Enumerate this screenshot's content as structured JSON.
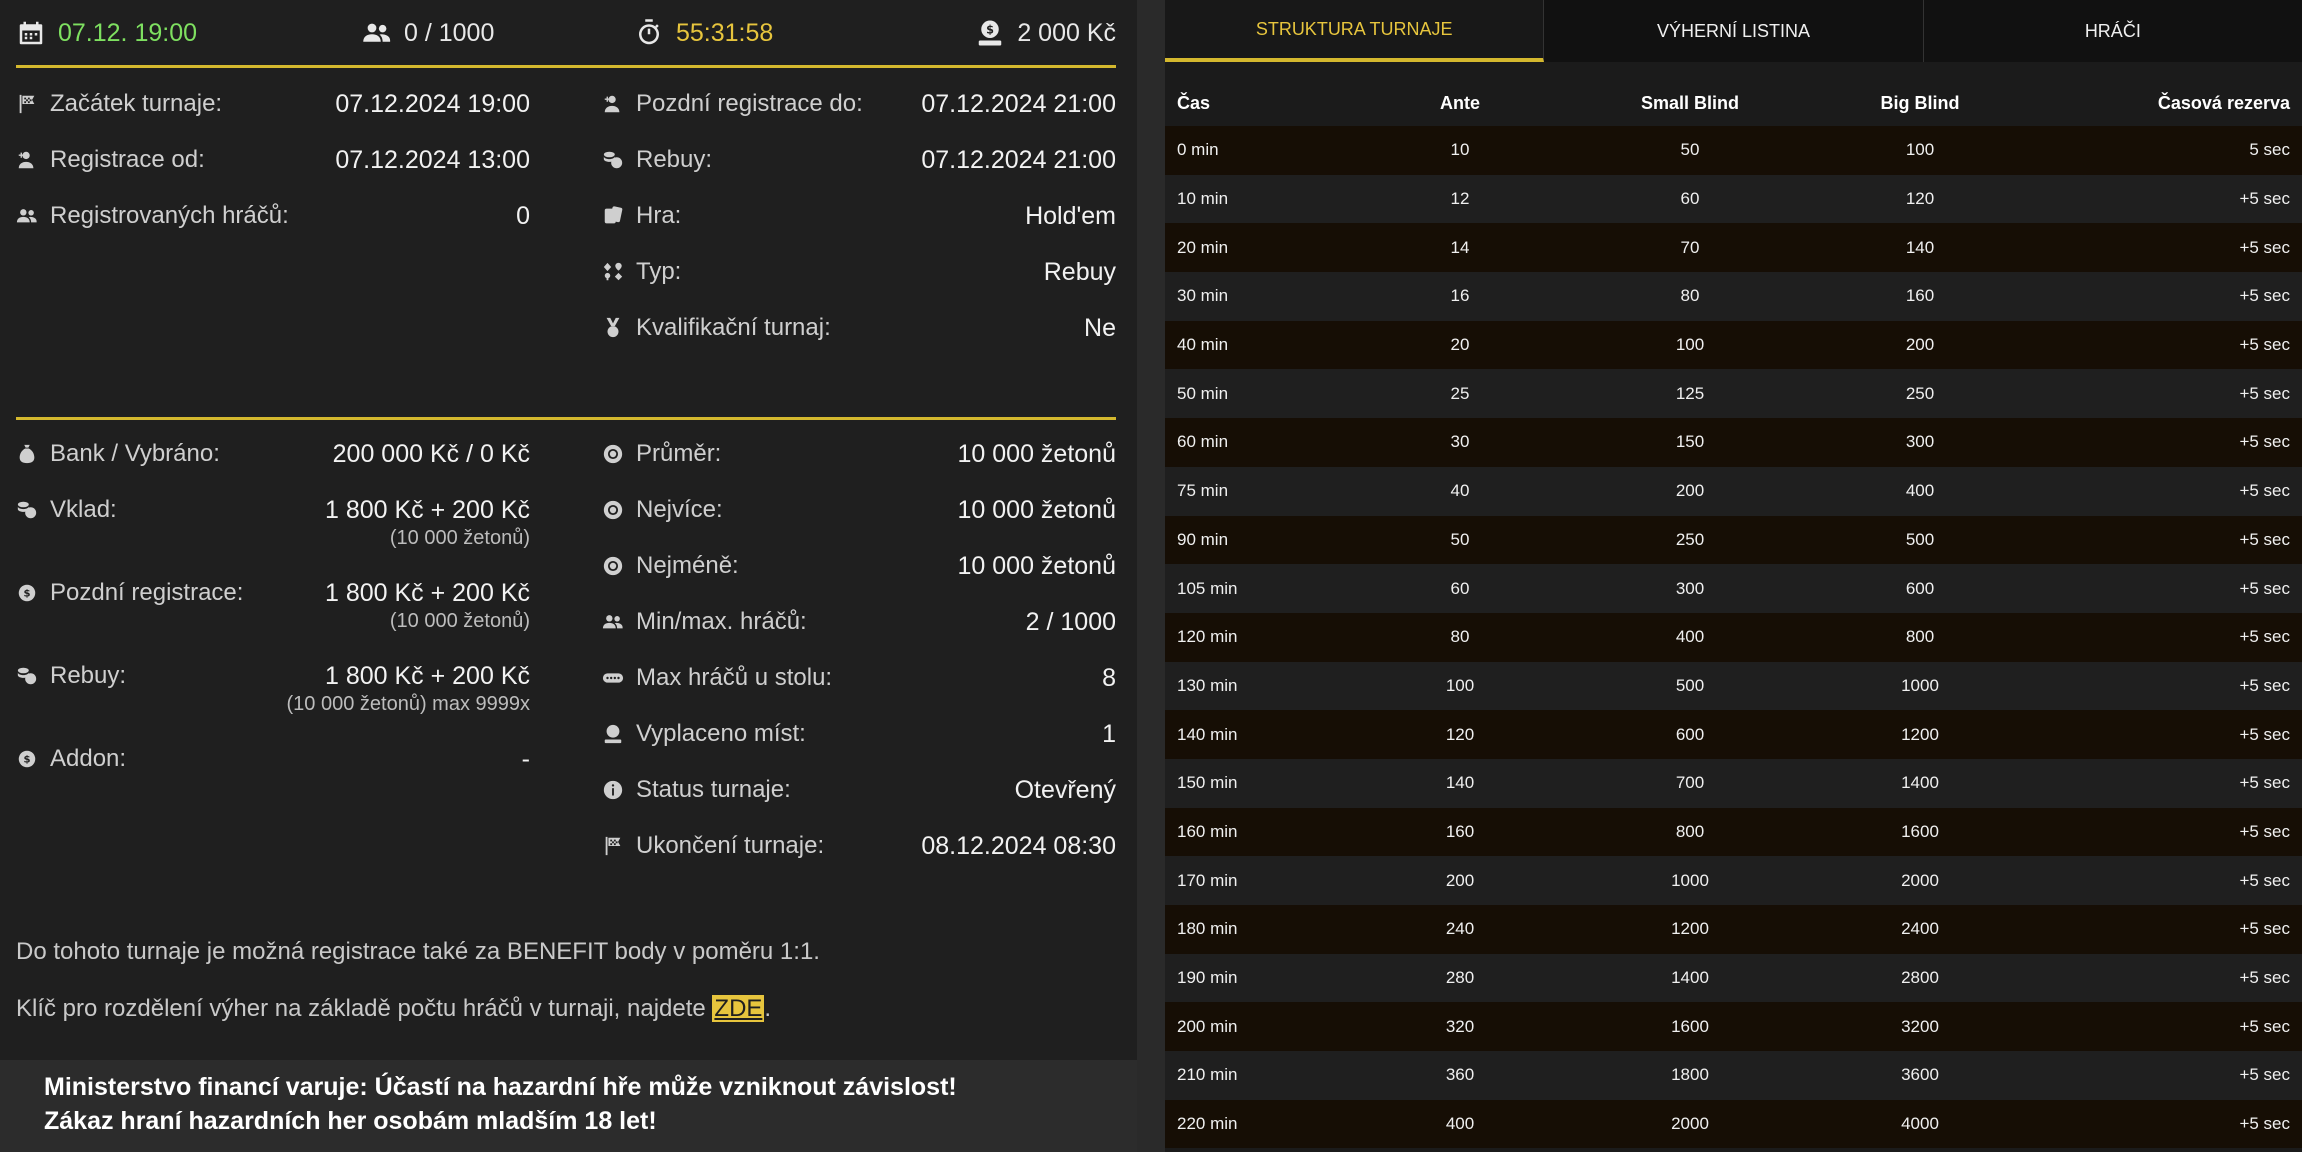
{
  "topbar": {
    "date": "07.12. 19:00",
    "players": "0 / 1000",
    "countdown": "55:31:58",
    "prize": "2 000 Kč"
  },
  "info_left": [
    {
      "label": "Začátek turnaje:",
      "value": "07.12.2024 19:00",
      "icon": "flag-icon"
    },
    {
      "label": "Registrace od:",
      "value": "07.12.2024 13:00",
      "icon": "user-add-icon"
    },
    {
      "label": "Registrovaných hráčů:",
      "value": "0",
      "icon": "users-icon"
    }
  ],
  "info_right": [
    {
      "label": "Pozdní registrace do:",
      "value": "07.12.2024 21:00",
      "icon": "user-add-icon"
    },
    {
      "label": "Rebuy:",
      "value": "07.12.2024 21:00",
      "icon": "coins-icon"
    },
    {
      "label": "Hra:",
      "value": "Hold'em",
      "icon": "cards-icon"
    },
    {
      "label": "Typ:",
      "value": "Rebuy",
      "icon": "suits-icon"
    },
    {
      "label": "Kvalifikační turnaj:",
      "value": "Ne",
      "icon": "medal-icon"
    }
  ],
  "money_left": [
    {
      "label": "Bank / Vybráno:",
      "value": "200 000 Kč / 0 Kč",
      "sub": "",
      "icon": "money-bag-icon"
    },
    {
      "label": "Vklad:",
      "value": "1 800 Kč + 200 Kč",
      "sub": "(10 000 žetonů)",
      "icon": "coins-icon"
    },
    {
      "label": "Pozdní registrace:",
      "value": "1 800 Kč + 200 Kč",
      "sub": "(10 000 žetonů)",
      "icon": "coin-icon"
    },
    {
      "label": "Rebuy:",
      "value": "1 800 Kč + 200 Kč",
      "sub": "(10 000 žetonů) max 9999x",
      "icon": "coins-icon"
    },
    {
      "label": "Addon:",
      "value": "-",
      "sub": "",
      "icon": "coin-icon"
    }
  ],
  "money_right": [
    {
      "label": "Průměr:",
      "value": "10 000 žetonů",
      "icon": "chip-icon"
    },
    {
      "label": "Nejvíce:",
      "value": "10 000 žetonů",
      "icon": "chip-icon"
    },
    {
      "label": "Nejméně:",
      "value": "10 000 žetonů",
      "icon": "chip-icon"
    },
    {
      "label": "Min/max. hráčů:",
      "value": "2 / 1000",
      "icon": "users-icon"
    },
    {
      "label": "Max hráčů u stolu:",
      "value": "8",
      "icon": "table-icon"
    },
    {
      "label": "Vyplaceno míst:",
      "value": "1",
      "icon": "prize-icon"
    },
    {
      "label": "Status turnaje:",
      "value": "Otevřený",
      "icon": "info-icon"
    },
    {
      "label": "Ukončení turnaje:",
      "value": "08.12.2024 08:30",
      "icon": "flag-icon"
    }
  ],
  "notes": {
    "benefit": "Do tohoto turnaje je možná registrace také za BENEFIT body v poměru 1:1.",
    "key_prefix": "Klíč pro rozdělení výher na základě počtu hráčů v turnaji, najdete ",
    "key_link": "ZDE",
    "key_suffix": "."
  },
  "warning": {
    "line1": "Ministerstvo financí varuje: Účastí na hazardní hře může vzniknout závislost!",
    "line2": "Zákaz hraní hazardních her osobám mladším 18 let!"
  },
  "tabs": [
    {
      "label": "STRUKTURA TURNAJE",
      "active": true
    },
    {
      "label": "VÝHERNÍ LISTINA",
      "active": false
    },
    {
      "label": "HRÁČI",
      "active": false
    }
  ],
  "structure": {
    "headers": [
      "Čas",
      "Ante",
      "Small Blind",
      "Big Blind",
      "Časová rezerva"
    ],
    "rows": [
      [
        "0 min",
        "10",
        "50",
        "100",
        "5 sec"
      ],
      [
        "10 min",
        "12",
        "60",
        "120",
        "+5 sec"
      ],
      [
        "20 min",
        "14",
        "70",
        "140",
        "+5 sec"
      ],
      [
        "30 min",
        "16",
        "80",
        "160",
        "+5 sec"
      ],
      [
        "40 min",
        "20",
        "100",
        "200",
        "+5 sec"
      ],
      [
        "50 min",
        "25",
        "125",
        "250",
        "+5 sec"
      ],
      [
        "60 min",
        "30",
        "150",
        "300",
        "+5 sec"
      ],
      [
        "75 min",
        "40",
        "200",
        "400",
        "+5 sec"
      ],
      [
        "90 min",
        "50",
        "250",
        "500",
        "+5 sec"
      ],
      [
        "105 min",
        "60",
        "300",
        "600",
        "+5 sec"
      ],
      [
        "120 min",
        "80",
        "400",
        "800",
        "+5 sec"
      ],
      [
        "130 min",
        "100",
        "500",
        "1000",
        "+5 sec"
      ],
      [
        "140 min",
        "120",
        "600",
        "1200",
        "+5 sec"
      ],
      [
        "150 min",
        "140",
        "700",
        "1400",
        "+5 sec"
      ],
      [
        "160 min",
        "160",
        "800",
        "1600",
        "+5 sec"
      ],
      [
        "170 min",
        "200",
        "1000",
        "2000",
        "+5 sec"
      ],
      [
        "180 min",
        "240",
        "1200",
        "2400",
        "+5 sec"
      ],
      [
        "190 min",
        "280",
        "1400",
        "2800",
        "+5 sec"
      ],
      [
        "200 min",
        "320",
        "1600",
        "3200",
        "+5 sec"
      ],
      [
        "210 min",
        "360",
        "1800",
        "3600",
        "+5 sec"
      ],
      [
        "220 min",
        "400",
        "2000",
        "4000",
        "+5 sec"
      ]
    ]
  },
  "colors": {
    "accent": "#d4b82e",
    "highlight": "#e7c53d",
    "green": "#7ee060"
  }
}
